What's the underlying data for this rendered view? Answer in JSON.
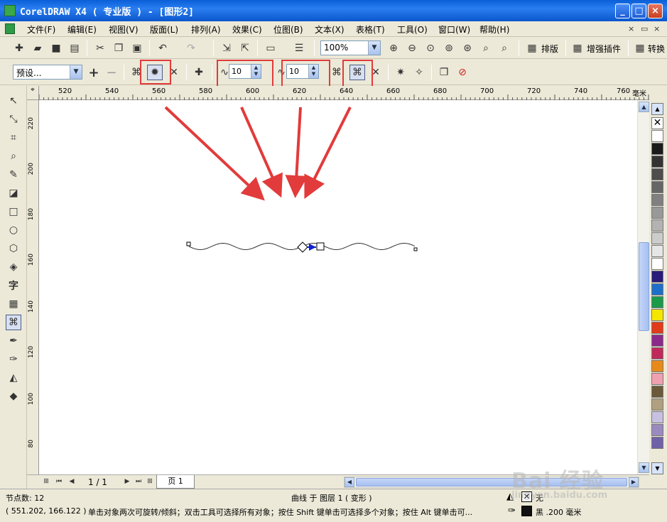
{
  "window": {
    "title": "CorelDRAW X4 ( 专业版 ) - [图形2]",
    "buttons": {
      "minimize": "_",
      "maximize": "□",
      "close": "×"
    }
  },
  "menu": {
    "items": [
      "文件(F)",
      "编辑(E)",
      "视图(V)",
      "版面(L)",
      "排列(A)",
      "效果(C)",
      "位图(B)",
      "文本(X)",
      "表格(T)",
      "工具(O)",
      "窗口(W)",
      "帮助(H)"
    ],
    "mdi": [
      "×",
      "▭",
      "×"
    ]
  },
  "toolbar_standard": {
    "zoom_value": "100%",
    "labels": [
      "排版",
      "增强插件",
      "转换"
    ]
  },
  "property_bar": {
    "preset_value": "预设...",
    "amplitude_value": "10",
    "frequency_value": "10"
  },
  "ruler": {
    "h_ticks": [
      "520",
      "540",
      "560",
      "580",
      "600",
      "620",
      "640",
      "660",
      "680",
      "700",
      "720",
      "740",
      "760"
    ],
    "h_unit": "毫米",
    "v_ticks": [
      "220",
      "200",
      "180",
      "160",
      "140",
      "120",
      "100",
      "80"
    ]
  },
  "page_nav": {
    "count": "1 / 1",
    "tab": "页 1"
  },
  "status": {
    "node_count": "节点数: 12",
    "object_info": "曲线 于 图层 1 ( 变形 )",
    "coords": "( 551.202, 166.122 )",
    "hint": "单击对象两次可旋转/倾斜；双击工具可选择所有对象；按住 Shift 键单击可选择多个对象；按住 Alt 键单击可...",
    "fill_label": "无",
    "outline_label": "黑  .200 毫米"
  },
  "watermark": {
    "brand": "Bai 经验",
    "url": "jingyan.baidu.com"
  },
  "colors": {
    "highlight": "#e23b3b",
    "palette": [
      "#ffffff",
      "#1a1a1a",
      "#333333",
      "#4d4d4d",
      "#666666",
      "#808080",
      "#999999",
      "#b3b3b3",
      "#cccccc",
      "#e6e6e6",
      "#ffffff",
      "#2a1a7a",
      "#1e6fc9",
      "#1b9a4a",
      "#f5e600",
      "#e23b1a",
      "#8b2a8a",
      "#c02a5a",
      "#e88a1a",
      "#f0a0b0",
      "#6a5a3a",
      "#b0a080",
      "#c8c0e0",
      "#9a8ac0",
      "#7060a8",
      "#5a4a98",
      "#8080a0",
      "#404060"
    ]
  }
}
